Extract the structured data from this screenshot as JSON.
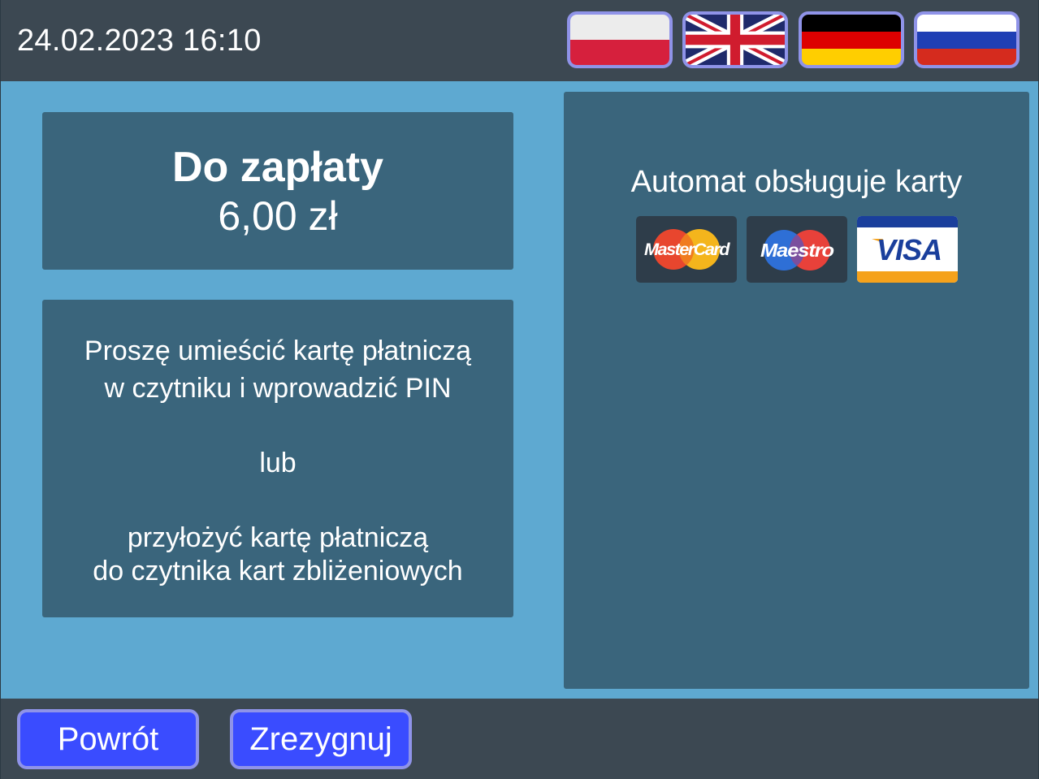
{
  "header": {
    "datetime": "24.02.2023 16:10"
  },
  "languages": [
    {
      "code": "pl",
      "icon": "poland-flag-icon"
    },
    {
      "code": "en",
      "icon": "uk-flag-icon"
    },
    {
      "code": "de",
      "icon": "germany-flag-icon"
    },
    {
      "code": "ru",
      "icon": "russia-flag-icon"
    }
  ],
  "payment": {
    "title": "Do zapłaty",
    "amount": "6,00 zł"
  },
  "instructions": {
    "line1": "Proszę umieścić kartę płatniczą",
    "line2": "w czytniku i wprowadzić PIN",
    "or": "lub",
    "line3": "przyłożyć kartę płatniczą",
    "line4": "do czytnika kart zbliżeniowych"
  },
  "cards": {
    "title": "Automat obsługuje karty",
    "logos": [
      {
        "name": "MasterCard",
        "icon": "mastercard-logo-icon"
      },
      {
        "name": "Maestro",
        "icon": "maestro-logo-icon"
      },
      {
        "name": "VISA",
        "icon": "visa-logo-icon"
      }
    ]
  },
  "footer": {
    "back_label": "Powrót",
    "cancel_label": "Zrezygnuj"
  },
  "colors": {
    "bar": "#3c4852",
    "background": "#5ea9d1",
    "panel": "#3a657c",
    "button": "#3a4cff",
    "button_border": "#8f93e8"
  }
}
